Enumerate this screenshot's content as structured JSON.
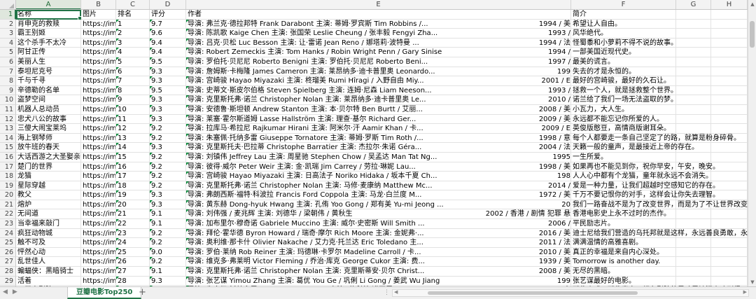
{
  "columns": [
    "A",
    "B",
    "C",
    "D",
    "E",
    "F",
    "G",
    "H",
    "I"
  ],
  "header_row": {
    "name": "名称",
    "image": "图片",
    "rank": "排名",
    "score": "评分",
    "author": "作者",
    "intro": "简介"
  },
  "rows": [
    {
      "n": "2",
      "name": "肖申克的救赎",
      "img": "https://imc",
      "rank": "1",
      "score": "9.7",
      "info": "导演: 弗兰克·德拉邦特 Frank Darabont   主演: 蒂姆·罗宾斯 Tim Robbins /...",
      "year": "1994 / 美",
      "intro": "希望让人自由。"
    },
    {
      "n": "3",
      "name": "霸王别姬",
      "img": "https://imc",
      "rank": "2",
      "score": "9.6",
      "info": "导演: 陈凯歌 Kaige Chen   主演: 张国荣 Leslie Cheung / 张丰毅 Fengyi Zha...",
      "year": "1993 /",
      "intro": "风华绝代。"
    },
    {
      "n": "4",
      "name": "这个杀手不太冷",
      "img": "https://imc",
      "rank": "3",
      "score": "9.4",
      "info": "导演: 吕克·贝松 Luc Besson   主演: 让·雷诺 Jean Reno / 娜塔莉·波特曼 ...",
      "year": "1994 / 法",
      "intro": "怪蜀黍和小萝莉不得不说的故事。"
    },
    {
      "n": "5",
      "name": "阿甘正传",
      "img": "https://imc",
      "rank": "4",
      "score": "9.4",
      "info": "导演: Robert Zemeckis   主演: Tom Hanks / Robin Wright Penn / Gary Sinise",
      "year": "1994 /",
      "intro": "一部美国近现代史。"
    },
    {
      "n": "6",
      "name": "美丽人生",
      "img": "https://imc",
      "rank": "5",
      "score": "9.5",
      "info": "导演: 罗伯托·贝尼尼 Roberto Benigni   主演: 罗伯托·贝尼尼 Roberto Beni...",
      "year": "1997 /",
      "intro": "最美的谎言。"
    },
    {
      "n": "7",
      "name": "泰坦尼克号",
      "img": "https://imc",
      "rank": "6",
      "score": "9.3",
      "info": "导演: 詹姆斯·卡梅隆 James Cameron   主演: 莱昂纳多·迪卡普里奥 Leonardo...",
      "year": "199",
      "intro": "失去的才是永恒的。"
    },
    {
      "n": "8",
      "name": "千与千寻",
      "img": "https://imc",
      "rank": "7",
      "score": "9.3",
      "info": "导演: 宫崎骏 Hayao Miyazaki   主演: 柊瑠美 Rumi Hîragi / 入野自由 Miy...",
      "year": "2001 / E",
      "intro": "最好的宫崎骏，最好的久石让。"
    },
    {
      "n": "9",
      "name": "辛德勒的名单",
      "img": "https://imc",
      "rank": "8",
      "score": "9.5",
      "info": "导演: 史蒂文·斯皮尔伯格 Steven Spielberg   主演: 连姆·尼森 Liam Neeson...",
      "year": "1993 /",
      "intro": "拯救一个人，就是拯救整个世界。"
    },
    {
      "n": "10",
      "name": "盗梦空间",
      "img": "https://imc",
      "rank": "9",
      "score": "9.3",
      "info": "导演: 克里斯托弗·诺兰 Christopher Nolan   主演: 莱昂纳多·迪卡普里奥 Le...",
      "year": "2010 /",
      "intro": "诺兰给了我们一场无法盗取的梦。"
    },
    {
      "n": "11",
      "name": "机器人总动员",
      "img": "https://imc",
      "rank": "10",
      "score": "9.3",
      "info": "导演: 安德鲁·斯坦顿 Andrew Stanton   主演: 本·贝尔特 Ben Burtt / 艾丽...",
      "year": "2008 / 美",
      "intro": "小瓦力，大人生。"
    },
    {
      "n": "12",
      "name": "忠犬八公的故事",
      "img": "https://imc",
      "rank": "11",
      "score": "9.3",
      "info": "导演: 莱塞·霍尔斯道姆 Lasse Hallström   主演: 理查·基尔 Richard Ger...",
      "year": "2009 / 美",
      "intro": "永远都不能忘记你所爱的人。"
    },
    {
      "n": "13",
      "name": "三傻大闹宝莱坞",
      "img": "https://imc",
      "rank": "12",
      "score": "9.2",
      "info": "导演: 拉库马·希拉尼 Rajkumar Hirani   主演: 阿米尔·汗 Aamir Khan / 卡...",
      "year": "2009 / E",
      "intro": "英俊版憨豆，高情商版谢耳朵。"
    },
    {
      "n": "14",
      "name": "海上钢琴师",
      "img": "https://imc",
      "rank": "13",
      "score": "9.2",
      "info": "导演: 朱塞佩·托纳多雷 Giuseppe Tornatore   主演: 蒂姆·罗斯 Tim Roth /...",
      "year": "1998 / 意",
      "intro": "每个人都要走一条自己坚定了的路，就算是粉身碎骨。"
    },
    {
      "n": "15",
      "name": "放牛班的春天",
      "img": "https://imc",
      "rank": "14",
      "score": "9.3",
      "info": "导演: 克里斯托夫·巴拉蒂 Christophe Barratier   主演: 杰拉尔·朱诺 Géra...",
      "year": "2004 / 法",
      "intro": "天籁一般的童声，是最接近上帝的存在。"
    },
    {
      "n": "16",
      "name": "大话西游之大圣娶亲",
      "img": "https://imc",
      "rank": "15",
      "score": "9.2",
      "info": "导演: 刘镇伟 Jeffrey Lau   主演: 周星驰 Stephen Chow / 吴孟达 Man Tat Ng...",
      "year": "1995",
      "intro": "一生所爱。"
    },
    {
      "n": "17",
      "name": "楚门的世界",
      "img": "https://imc",
      "rank": "16",
      "score": "9.2",
      "info": "导演: 彼得·威尔 Peter Weir   主演: 金·凯瑞 Jim Carrey / 劳拉·琳妮 Lau...",
      "year": "1998 / 美",
      "intro": "如果再也不能见到你，祝你早安，午安，晚安。"
    },
    {
      "n": "18",
      "name": "龙猫",
      "img": "https://imc",
      "rank": "17",
      "score": "9.2",
      "info": "导演: 宫崎骏 Hayao Miyazaki   主演: 日高法子 Noriko Hidaka / 坂本千夏 Ch...",
      "year": "198",
      "intro": "人人心中都有个龙猫，童年就永远不会消失。"
    },
    {
      "n": "19",
      "name": "星际穿越",
      "img": "https://imc",
      "rank": "18",
      "score": "9.2",
      "info": "导演: 克里斯托弗·诺兰 Christopher Nolan   主演: 马修·麦康纳 Matthew Mc...",
      "year": "2014 /",
      "intro": "爱是一种力量，让我们超越时空感知它的存在。"
    },
    {
      "n": "20",
      "name": "教父",
      "img": "https://imc",
      "rank": "19",
      "score": "9.3",
      "info": "导演: 弗朗西斯·福特·科波拉 Francis Ford Coppola   主演: 马龙·白兰度 M...",
      "year": "1972 / 美",
      "intro": "千万不要记恨你的对手，这样会让你失去理智。"
    },
    {
      "n": "21",
      "name": "熔炉",
      "img": "https://imc",
      "rank": "20",
      "score": "9.3",
      "info": "导演: 黄东赫 Dong-hyuk Hwang   主演: 孔侑 Yoo Gong / 郑有美 Yu-mi Jeong ...",
      "year": "20",
      "intro": "我们一路奋战不是为了改变世界，而是为了不让世界改变我们。"
    },
    {
      "n": "22",
      "name": "无间道",
      "img": "https://imc",
      "rank": "21",
      "score": "9.1",
      "info": "导演: 刘伟强 / 麦兆辉   主演: 刘德华 / 梁朝伟 / 黄秋生",
      "year": "2002 / 香港 / 剧情 犯罪 悬",
      "intro": "香港电影史上永不过时的杰作。"
    },
    {
      "n": "23",
      "name": "当幸福来敲门",
      "img": "https://imc",
      "rank": "22",
      "score": "9.1",
      "info": "导演: 加布里尔·穆奇诺 Gabriele Muccino   主演: 威尔·史密斯 Will Smith ...",
      "year": "2006 /",
      "intro": "平民励志片。"
    },
    {
      "n": "24",
      "name": "疯狂动物城",
      "img": "https://imc",
      "rank": "23",
      "score": "9.2",
      "info": "导演: 拜伦·霍华德 Byron Howard / 瑞奇·摩尔 Rich Moore   主演: 金妮弗·...",
      "year": "2016 / 美",
      "intro": "迪士尼给我们营造的乌托邦就是这样，永远善良勇敢，永远出乎意料。"
    },
    {
      "n": "25",
      "name": "触不可及",
      "img": "https://imc",
      "rank": "24",
      "score": "9.2",
      "info": "导演: 奥利维·那卡什 Olivier Nakache / 艾力克·托兰达 Eric Toledano   主...",
      "year": "2011 / 法",
      "intro": "满满温情的高雅喜剧。"
    },
    {
      "n": "26",
      "name": "怦然心动",
      "img": "https://imc",
      "rank": "25",
      "score": "9.0",
      "info": "导演: 罗伯·莱纳 Rob Reiner   主演: 玛德琳·卡罗尔 Madeline Carroll / 卡...",
      "year": "2010 / 美",
      "intro": "真正的幸福是来自内心深处。"
    },
    {
      "n": "27",
      "name": "乱世佳人",
      "img": "https://imc",
      "rank": "26",
      "score": "9.2",
      "info": "导演: 维克多·弗莱明 Victor Fleming / 乔治·库克 George Cukor   主演: 费...",
      "year": "1939 / 美",
      "intro": "Tomorrow is another day."
    },
    {
      "n": "28",
      "name": "蝙蝠侠：黑暗骑士",
      "img": "https://imc",
      "rank": "27",
      "score": "9.1",
      "info": "导演: 克里斯托弗·诺兰 Christopher Nolan   主演: 克里斯蒂安·贝尔 Christ...",
      "year": "2008 / 美",
      "intro": "无尽的黑暗。"
    },
    {
      "n": "29",
      "name": "活着",
      "img": "https://imc",
      "rank": "28",
      "score": "9.3",
      "info": "导演: 张艺谋 Yimou Zhang   主演: 葛优 You Ge / 巩俐 Li Gong / 姜武 Wu Jiang",
      "year": "199",
      "intro": "张艺谋最好的电影。"
    },
    {
      "n": "30",
      "name": "天堂电影院",
      "img": "https://imc",
      "rank": "29",
      "score": "9.1",
      "info": "导演: 朱塞佩·托纳多雷 Giuseppe Tornatore   主演: 菲利普·诺瓦雷 Philippe Noiret",
      "year": "1988 / 意",
      "intro": "那些吻戏，那些青春，都在影院的黑暗里被泪水冲刷得..."
    }
  ],
  "sheet_tab": "豆瓣电影Top250",
  "add_sheet": "+",
  "colors": {
    "accent": "#217346",
    "gridline": "#e2e2e2",
    "header_bg": "#f3f3f3"
  }
}
